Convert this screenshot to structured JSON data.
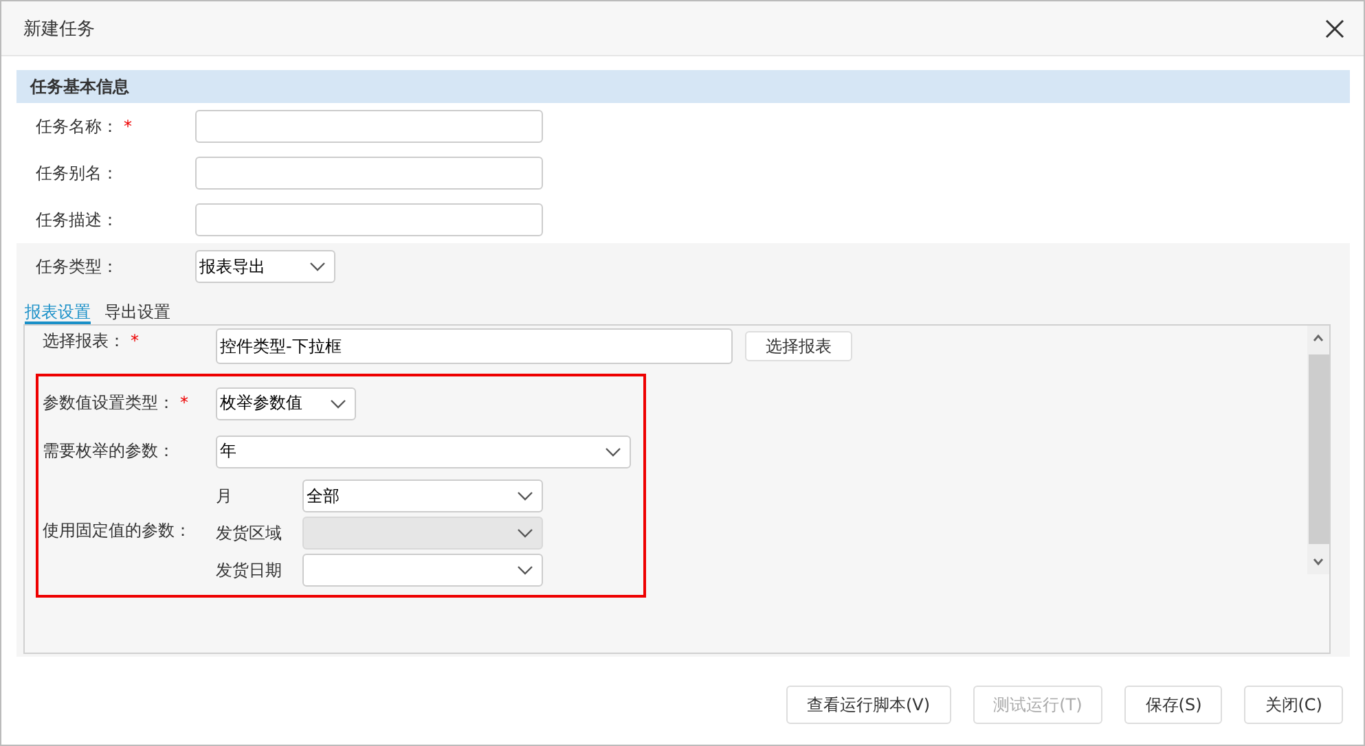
{
  "window": {
    "title": "新建任务"
  },
  "required_mark": "*",
  "section": {
    "title": "任务基本信息"
  },
  "fields": [
    {
      "label": "任务名称：",
      "required": true
    },
    {
      "label": "任务别名：",
      "required": false
    },
    {
      "label": "任务描述：",
      "required": false
    }
  ],
  "task_type": {
    "label": "任务类型：",
    "value": "报表导出"
  },
  "tabs": [
    {
      "label": "报表设置",
      "selected": true
    },
    {
      "label": "导出设置",
      "selected": false
    }
  ],
  "report": {
    "label": "选择报表：",
    "required": true,
    "value": "控件类型-下拉框",
    "button": "选择报表"
  },
  "param_setting": {
    "label": "参数值设置类型：",
    "required": true,
    "value": "枚举参数值"
  },
  "enum_param": {
    "label": "需要枚举的参数：",
    "value": "年"
  },
  "fixed_params": {
    "label": "使用固定值的参数：",
    "items": [
      {
        "name": "月",
        "value": "全部",
        "disabled": false
      },
      {
        "name": "发货区域",
        "disabled": true
      },
      {
        "name": "发货日期",
        "disabled": false
      }
    ]
  },
  "buttons": [
    {
      "label": "查看运行脚本(V)",
      "disabled": false
    },
    {
      "label": "测试运行(T)",
      "disabled": true
    },
    {
      "label": "保存(S)",
      "disabled": false
    },
    {
      "label": "关闭(C)",
      "disabled": false
    }
  ]
}
